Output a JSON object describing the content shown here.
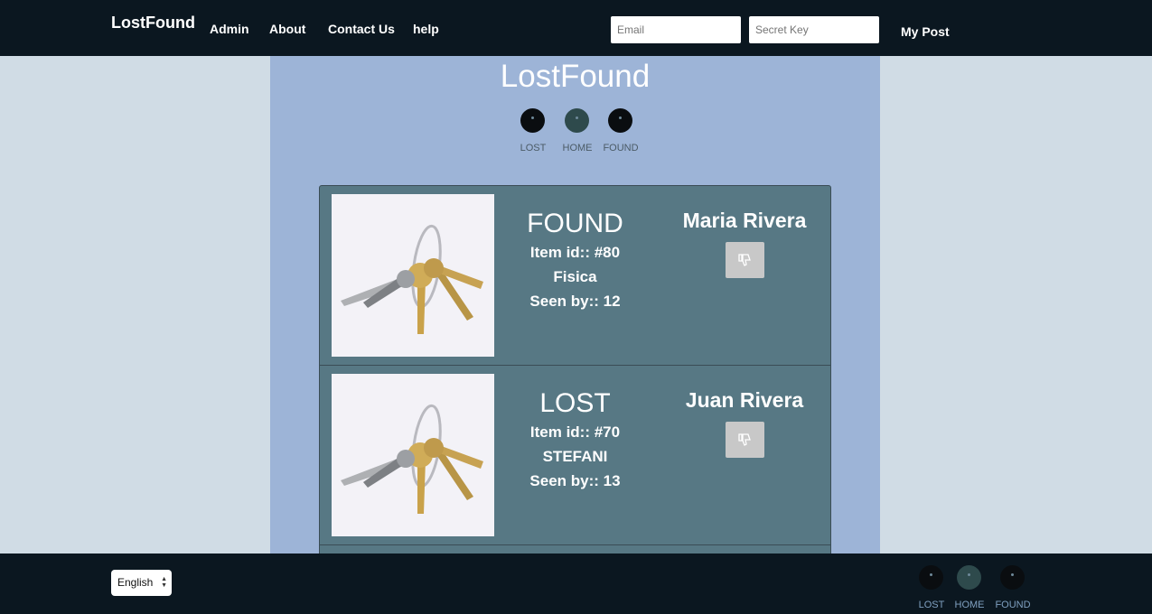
{
  "nav": {
    "brand": "LostFound",
    "links": [
      "Admin",
      "About",
      "Contact Us",
      "help"
    ],
    "email_placeholder": "Email",
    "secret_placeholder": "Secret Key",
    "my_post": "My Post"
  },
  "header": {
    "title": "LostFound",
    "switcher": [
      "LOST",
      "HOME",
      "FOUND"
    ]
  },
  "posts": [
    {
      "status": "FOUND",
      "item_id": "Item id:: #80",
      "location": "Fisica",
      "seen_by": "Seen by:: 12",
      "owner": "Maria Rivera"
    },
    {
      "status": "LOST",
      "item_id": "Item id:: #70",
      "location": "STEFANI",
      "seen_by": "Seen by:: 13",
      "owner": "Juan Rivera"
    }
  ],
  "footer": {
    "language": "English",
    "switcher": [
      "LOST",
      "HOME",
      "FOUND"
    ]
  },
  "colors": {
    "topbar": "#0b1720",
    "page_bg": "#d0dce5",
    "main_bg": "#9db4d7",
    "card_bg": "#577884"
  },
  "icons": {
    "dislike": "thumbs-down-icon"
  }
}
